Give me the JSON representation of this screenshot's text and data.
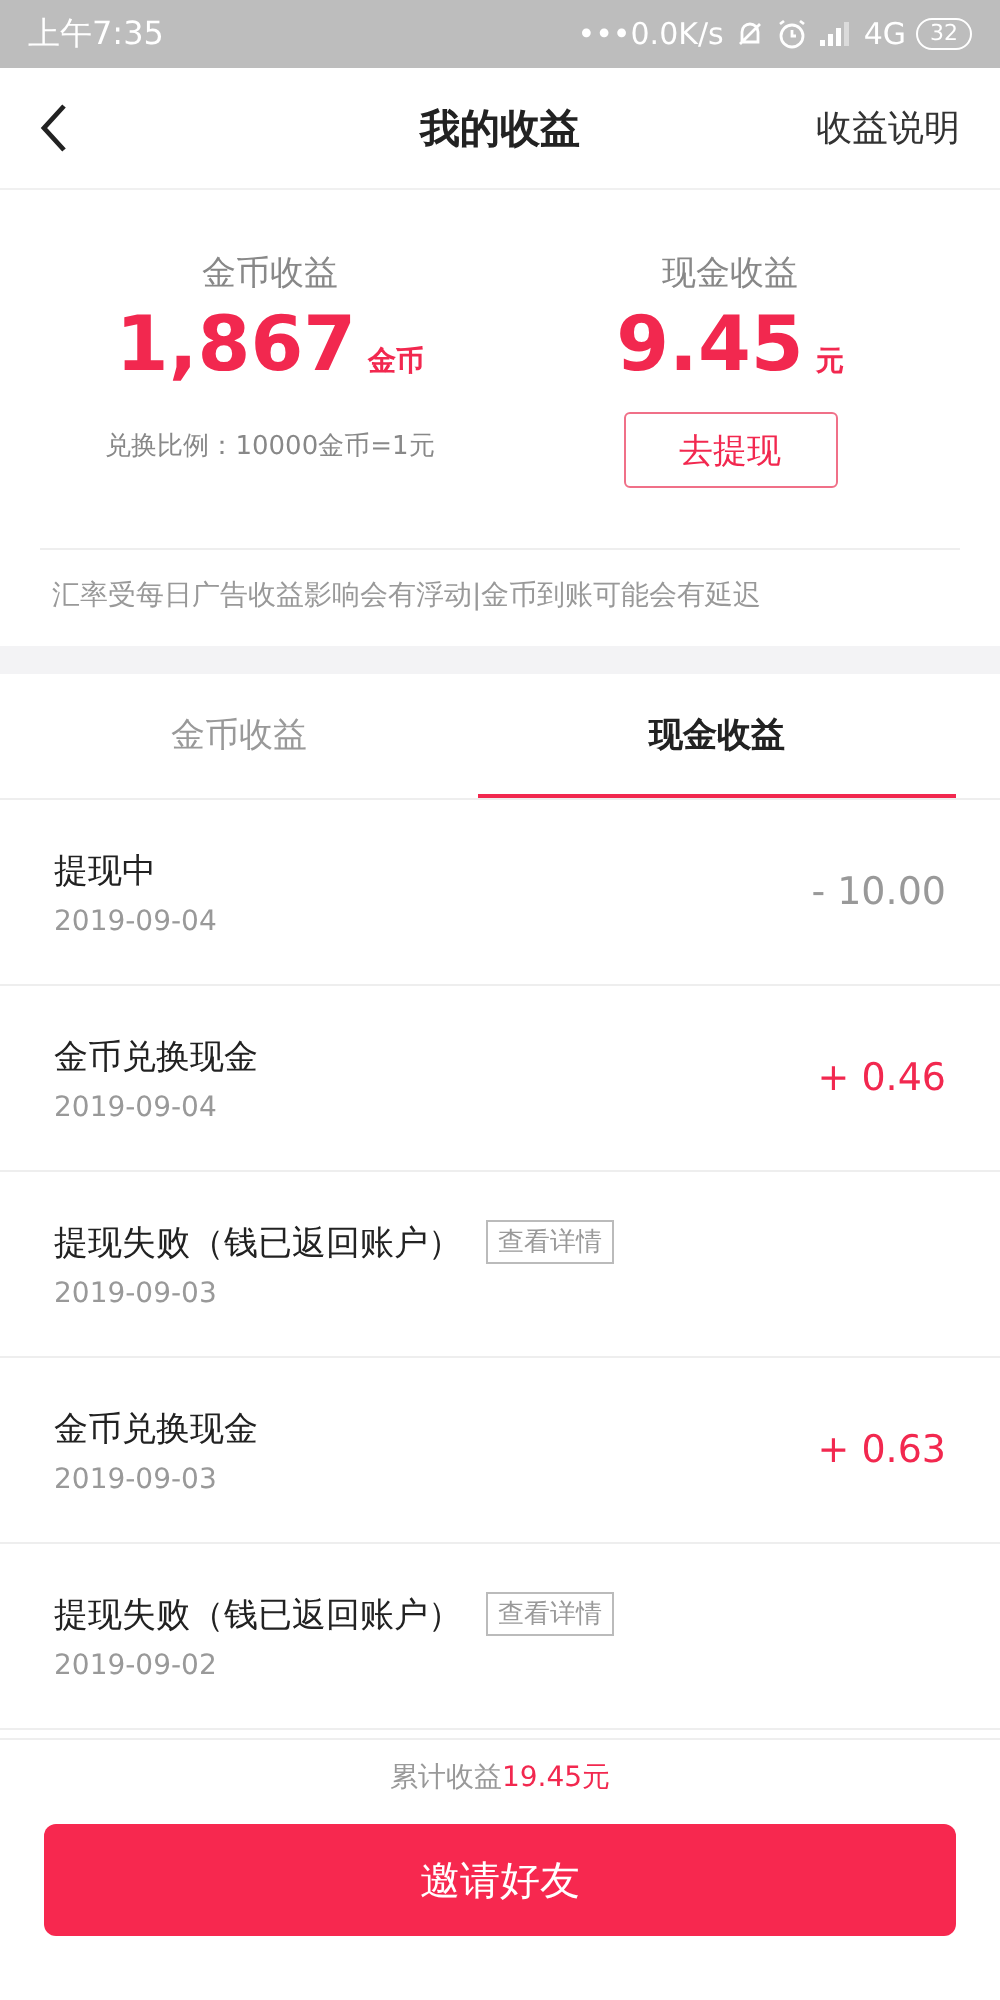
{
  "status_bar": {
    "time": "上午7:35",
    "net_speed": "•••0.0K/s",
    "network": "4G",
    "battery": "32"
  },
  "header": {
    "title": "我的收益",
    "action": "收益说明"
  },
  "summary": {
    "coins": {
      "label": "金币收益",
      "value": "1,867",
      "unit": "金币",
      "note": "兑换比例：10000金币=1元"
    },
    "cash": {
      "label": "现金收益",
      "value": "9.45",
      "unit": "元",
      "button": "去提现"
    },
    "notice": "汇率受每日广告收益影响会有浮动|金币到账可能会有延迟"
  },
  "tabs": [
    {
      "label": "金币收益",
      "selected": false
    },
    {
      "label": "现金收益",
      "selected": true
    }
  ],
  "records": [
    {
      "kind": "debit",
      "title": "提现中",
      "date": "2019-09-04",
      "amount": "- 10.00"
    },
    {
      "kind": "credit",
      "title": "金币兑换现金",
      "date": "2019-09-04",
      "amount": "+ 0.46"
    },
    {
      "kind": "failed",
      "title": "提现失败（钱已返回账户）",
      "date": "2019-09-03",
      "link": "查看详情"
    },
    {
      "kind": "credit",
      "title": "金币兑换现金",
      "date": "2019-09-03",
      "amount": "+ 0.63"
    },
    {
      "kind": "failed",
      "title": "提现失败（钱已返回账户）",
      "date": "2019-09-02",
      "link": "查看详情"
    }
  ],
  "footer": {
    "total_label": "累计收益",
    "total_value": "19.45元",
    "button": "邀请好友"
  }
}
